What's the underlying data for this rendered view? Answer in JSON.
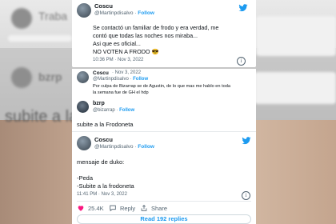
{
  "tweet1": {
    "name": "Coscu",
    "handle": "@Martinpdisalvo",
    "follow": "Follow",
    "lines": [
      "Se contactó un familiar de frodo y era verdad, me",
      "contó que todas las noches nos miraba...",
      "Asi que es oficial...",
      "NO VOTEN A FRODO 😎"
    ],
    "time": "10:36 PM · Nov 3, 2022"
  },
  "tweet2": {
    "name": "Coscu",
    "date": "Nov 3, 2022",
    "handle": "@Martinpdisalvo",
    "follow": "Follow",
    "lines": [
      "Por culpa de Bizarrap se de Agustin, de lo que mas me hablo en toda",
      "la semana fue de GH el hdp"
    ]
  },
  "tweet3": {
    "name": "bzrp",
    "handle": "@bizarrap",
    "follow": "Follow",
    "text": "subite a la Frodoneta"
  },
  "tweet4": {
    "name": "Coscu",
    "handle": "@Martinpdisalvo",
    "follow": "Follow",
    "lines": [
      "mensaje de duko:",
      "",
      "-Peda",
      "-Subite a la frodoneta"
    ],
    "time": "11:41 PM · Nov 3, 2022",
    "likes": "25.4K",
    "reply": "Reply",
    "share": "Share",
    "replies_button": "Read 192 replies"
  },
  "background": {
    "left_text": "Traba",
    "mid_text": "subite a la fro",
    "mid_handle": "bzrp"
  },
  "colors": {
    "twitter_blue": "#1d9bf0",
    "like_red": "#f91880"
  }
}
